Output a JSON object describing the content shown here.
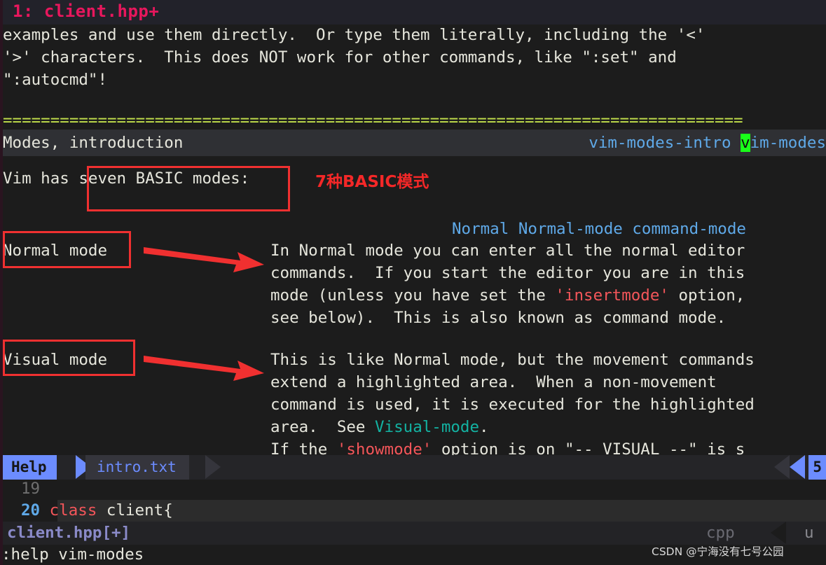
{
  "tabline": {
    "label": "1: client.hpp+"
  },
  "help": {
    "top_lines": [
      "examples and use them directly.  Or type them literally, including the '<'",
      "'>' characters.  This does NOT work for other commands, like \":set\" and",
      "\":autocmd\"!"
    ],
    "separator": "==============================================================================",
    "section_header": {
      "title": "Modes, introduction",
      "tag1": "vim-modes-intro",
      "tag2_cursor_char": "v",
      "tag2_rest": "im-modes"
    },
    "intro_line_prefix": "Vim has ",
    "intro_line_boxed": "seven BASIC modes:",
    "normal_links": "Normal Normal-mode command-mode",
    "normal_mode_label": "Normal mode",
    "normal_body": [
      "In Normal mode you can enter all the normal editor",
      "commands.  If you start the editor you are in this",
      "mode (unless you have set the 'insertmode' option,",
      "see below).  This is also known as command mode."
    ],
    "normal_body_option": "'insertmode'",
    "visual_mode_label": "Visual mode",
    "visual_body": [
      "This is like Normal mode, but the movement commands",
      "extend a highlighted area.  When a non-movement",
      "command is used, it is executed for the highlighted",
      "area.  See Visual-mode.",
      "If the 'showmode' option is on \"-- VISUAL --\" is s"
    ],
    "visual_link": "Visual-mode",
    "visual_body_option": "'showmode'"
  },
  "annotations": {
    "chinese_note": "7种BASIC模式",
    "box_color": "#f03030",
    "arrow_color": "#f03030"
  },
  "statusline": {
    "mode": "Help",
    "filename": "intro.txt",
    "lock_icon": "lock-icon",
    "right_value": "5"
  },
  "code": {
    "lines": [
      {
        "num": "19",
        "text": ""
      },
      {
        "num": "20",
        "keyword": "class",
        "rest": " client{"
      }
    ]
  },
  "lower_status": {
    "filename": "client.hpp[+]",
    "filetype": "cpp",
    "encoding": "u"
  },
  "cmdline": {
    "text": ":help vim-modes"
  },
  "watermark": {
    "text": "CSDN @宁海没有七号公园"
  },
  "colors": {
    "background": "#1c1c1c",
    "foreground": "#e6e6dc",
    "tab_accent": "#e8175d",
    "link": "#5fa9e8",
    "teal": "#13b2a2",
    "option_red": "#f4565a",
    "separator": "#c3e14c",
    "cursor_green": "#19ff19",
    "statusline_blue": "#6c8cff"
  }
}
